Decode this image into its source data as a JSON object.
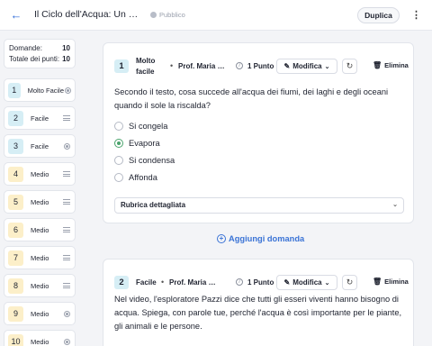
{
  "header": {
    "title": "Il Ciclo dell'Acqua: Un Viaggio nel Tempo",
    "status": "Pubblico",
    "duplicate_label": "Duplica"
  },
  "stats": {
    "domande_label": "Domande:",
    "domande_value": "10",
    "punti_label": "Totale dei punti:",
    "punti_value": "10"
  },
  "sidebar": {
    "items": [
      {
        "num": "1",
        "difficulty": "Molto Facile",
        "type": "radio"
      },
      {
        "num": "2",
        "difficulty": "Facile",
        "type": "lines"
      },
      {
        "num": "3",
        "difficulty": "Facile",
        "type": "radio"
      },
      {
        "num": "4",
        "difficulty": "Medio",
        "type": "lines"
      },
      {
        "num": "5",
        "difficulty": "Medio",
        "type": "lines"
      },
      {
        "num": "6",
        "difficulty": "Medio",
        "type": "lines"
      },
      {
        "num": "7",
        "difficulty": "Medio",
        "type": "lines"
      },
      {
        "num": "8",
        "difficulty": "Medio",
        "type": "lines"
      },
      {
        "num": "9",
        "difficulty": "Medio",
        "type": "radio"
      },
      {
        "num": "10",
        "difficulty": "Medio",
        "type": "radio"
      }
    ]
  },
  "questions": [
    {
      "num": "1",
      "difficulty_line1": "Molto",
      "difficulty_line2": "facile",
      "author": "Prof. Maria Grazia",
      "points": "1 Punto",
      "edit_label": "Modifica",
      "delete_label": "Elimina",
      "text": "Secondo il testo, cosa succede all'acqua dei fiumi, dei laghi e degli oceani quando il sole la riscalda?",
      "options": [
        "Si congela",
        "Evapora",
        "Si condensa",
        "Affonda"
      ],
      "selected": 1,
      "rubric_label": "Rubrica dettagliata"
    },
    {
      "num": "2",
      "difficulty": "Facile",
      "author": "Prof. Maria Grazia",
      "points": "1 Punto",
      "edit_label": "Modifica",
      "delete_label": "Elimina",
      "text": "Nel video, l'esploratore Pazzi dice che tutti gli esseri viventi hanno bisogno di acqua. Spiega, con parole tue, perché l'acqua è così importante per le piante, gli animali e le persone."
    }
  ],
  "add_question_label": "Aggiungi domanda"
}
